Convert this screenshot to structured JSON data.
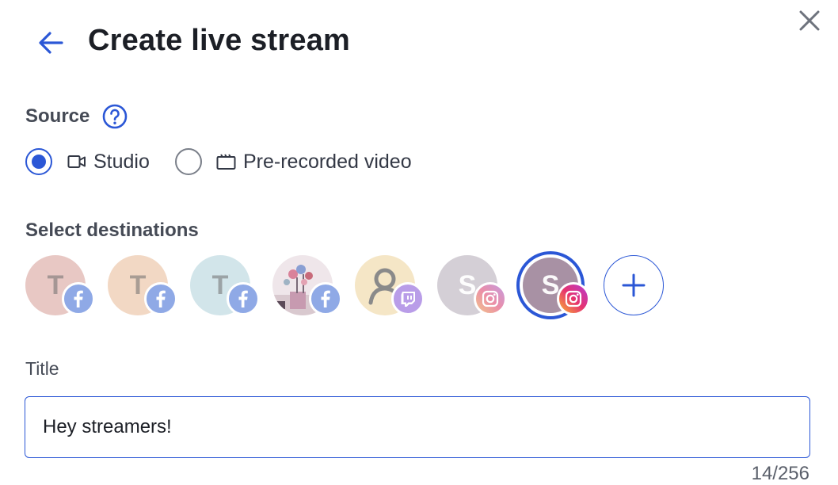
{
  "header": {
    "title": "Create live stream",
    "back_icon": "arrow-left-icon",
    "close_icon": "close-icon"
  },
  "source": {
    "label": "Source",
    "help_icon": "question-circle-icon",
    "options": [
      {
        "label": "Studio",
        "icon": "video-camera-icon",
        "checked": true
      },
      {
        "label": "Pre-recorded video",
        "icon": "film-clapper-icon",
        "checked": false
      }
    ]
  },
  "destinations": {
    "label": "Select destinations",
    "items": [
      {
        "initial": "T",
        "platform": "facebook",
        "selected": false
      },
      {
        "initial": "T",
        "platform": "facebook",
        "selected": false
      },
      {
        "initial": "T",
        "platform": "facebook",
        "selected": false
      },
      {
        "initial": "",
        "platform": "facebook",
        "selected": false
      },
      {
        "initial": "",
        "platform": "twitch",
        "selected": false
      },
      {
        "initial": "S",
        "platform": "instagram",
        "selected": false
      },
      {
        "initial": "S",
        "platform": "instagram",
        "selected": true
      }
    ],
    "add_icon": "plus-icon"
  },
  "title_field": {
    "label": "Title",
    "value": "Hey streamers!",
    "counter": "14/256"
  },
  "colors": {
    "accent": "#2b57d6"
  }
}
